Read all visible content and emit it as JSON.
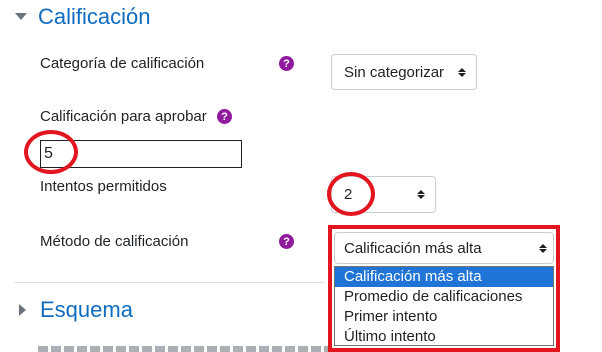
{
  "section1": {
    "title": "Calificación"
  },
  "categoria": {
    "label": "Categoría de calificación",
    "value": "Sin categorizar"
  },
  "aprobar": {
    "label": "Calificación para aprobar",
    "value": "5"
  },
  "intentos": {
    "label": "Intentos permitidos",
    "value": "2"
  },
  "metodo": {
    "label": "Método de calificación",
    "value": "Calificación más alta",
    "options": [
      "Calificación más alta",
      "Promedio de calificaciones",
      "Primer intento",
      "Último intento"
    ],
    "selected_index": 0
  },
  "section2": {
    "title": "Esquema"
  },
  "help_glyph": "?",
  "colors": {
    "accent": "#0f6cbf",
    "highlight": "#e3151e",
    "help_icon": "#8f1a9e",
    "selected_option": "#1f74d6"
  },
  "icons": {
    "collapse": "chevron-down-icon",
    "expand": "chevron-right-icon",
    "help": "question-circle-icon"
  }
}
